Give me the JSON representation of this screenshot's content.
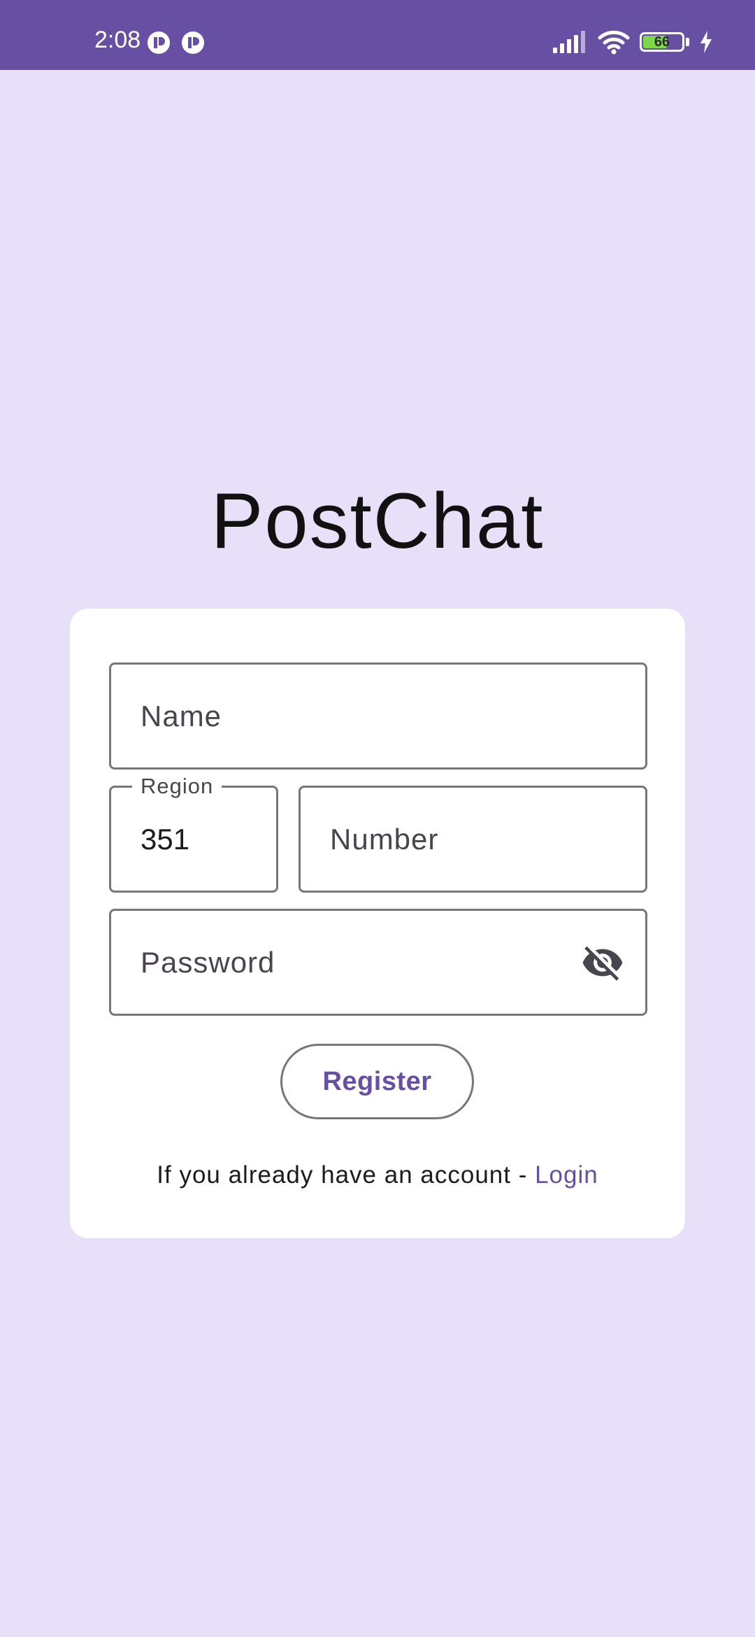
{
  "status_bar": {
    "time": "2:08",
    "battery_level": "66",
    "battery_fraction": 0.66,
    "background": "#6750A4",
    "icons": [
      "notification-app-icon",
      "notification-app-icon",
      "signal-icon",
      "wifi-icon",
      "battery-icon",
      "charging-bolt-icon"
    ]
  },
  "app": {
    "title": "PostChat",
    "background": "#E8E0F8",
    "accent": "#6750A4"
  },
  "form": {
    "name": {
      "placeholder": "Name",
      "value": ""
    },
    "region": {
      "label": "Region",
      "value": "351"
    },
    "number": {
      "placeholder": "Number",
      "value": ""
    },
    "password": {
      "placeholder": "Password",
      "value": "",
      "toggle_icon": "visibility-off-icon"
    },
    "register_label": "Register",
    "login_prompt": "If you already have an account - ",
    "login_link": "Login"
  }
}
